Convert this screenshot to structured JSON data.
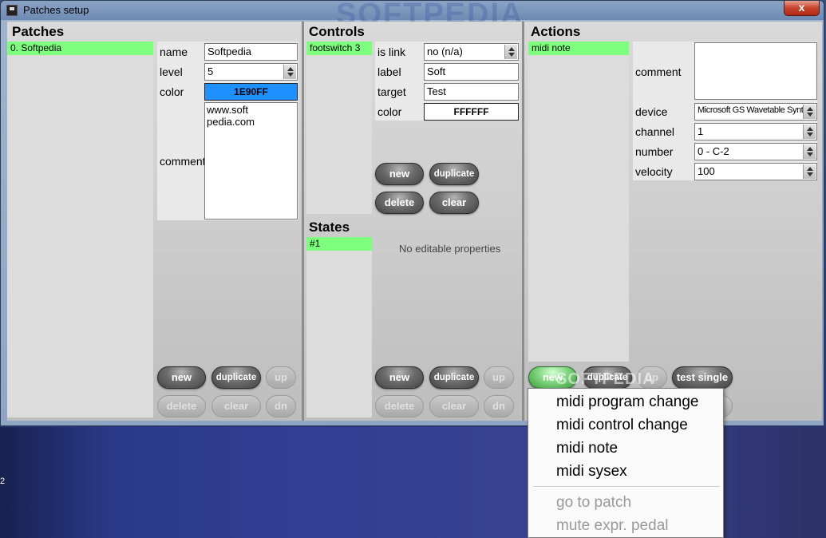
{
  "window": {
    "title": "Patches setup",
    "close_label": "x",
    "watermark": "SOFTPEDIA"
  },
  "desktop": {
    "glyph": "2"
  },
  "patches": {
    "title": "Patches",
    "items": [
      "0. Softpedia"
    ],
    "props": {
      "name_label": "name",
      "name_value": "Softpedia",
      "level_label": "level",
      "level_value": "5",
      "color_label": "color",
      "color_value": "1E90FF",
      "comment_label": "comment",
      "comment_value": "www.soft\npedia.com"
    },
    "buttons": {
      "new": "new",
      "duplicate": "duplicate",
      "up": "up",
      "delete": "delete",
      "clear": "clear",
      "dn": "dn"
    }
  },
  "controls": {
    "title": "Controls",
    "items": [
      "footswitch 3"
    ],
    "props": {
      "islink_label": "is link",
      "islink_value": "no (n/a)",
      "label_label": "label",
      "label_value": "Soft",
      "target_label": "target",
      "target_value": "Test",
      "color_label": "color",
      "color_value": "FFFFFF"
    },
    "buttons": {
      "new": "new",
      "duplicate": "duplicate",
      "delete": "delete",
      "clear": "clear"
    }
  },
  "states": {
    "title": "States",
    "items": [
      "#1"
    ],
    "note": "No editable properties",
    "buttons": {
      "new": "new",
      "duplicate": "duplicate",
      "up": "up",
      "delete": "delete",
      "clear": "clear",
      "dn": "dn"
    }
  },
  "actions": {
    "title": "Actions",
    "items": [
      "midi note"
    ],
    "props": {
      "comment_label": "comment",
      "comment_value": "",
      "device_label": "device",
      "device_value": "Microsoft GS Wavetable Synth",
      "channel_label": "channel",
      "channel_value": "1",
      "number_label": "number",
      "number_value": "0 - C-2",
      "velocity_label": "velocity",
      "velocity_value": "100"
    },
    "buttons": {
      "new": "new",
      "duplicate": "duplicate",
      "up": "up",
      "test_single": "test single"
    }
  },
  "new_action_menu": {
    "items": [
      "midi program change",
      "midi control change",
      "midi note",
      "midi sysex"
    ],
    "disabled_items": [
      "go to patch",
      "mute expr. pedal"
    ]
  },
  "colors": {
    "selection": "#7dff7d",
    "patch_color": "#1E90FF",
    "control_color": "#FFFFFF"
  }
}
